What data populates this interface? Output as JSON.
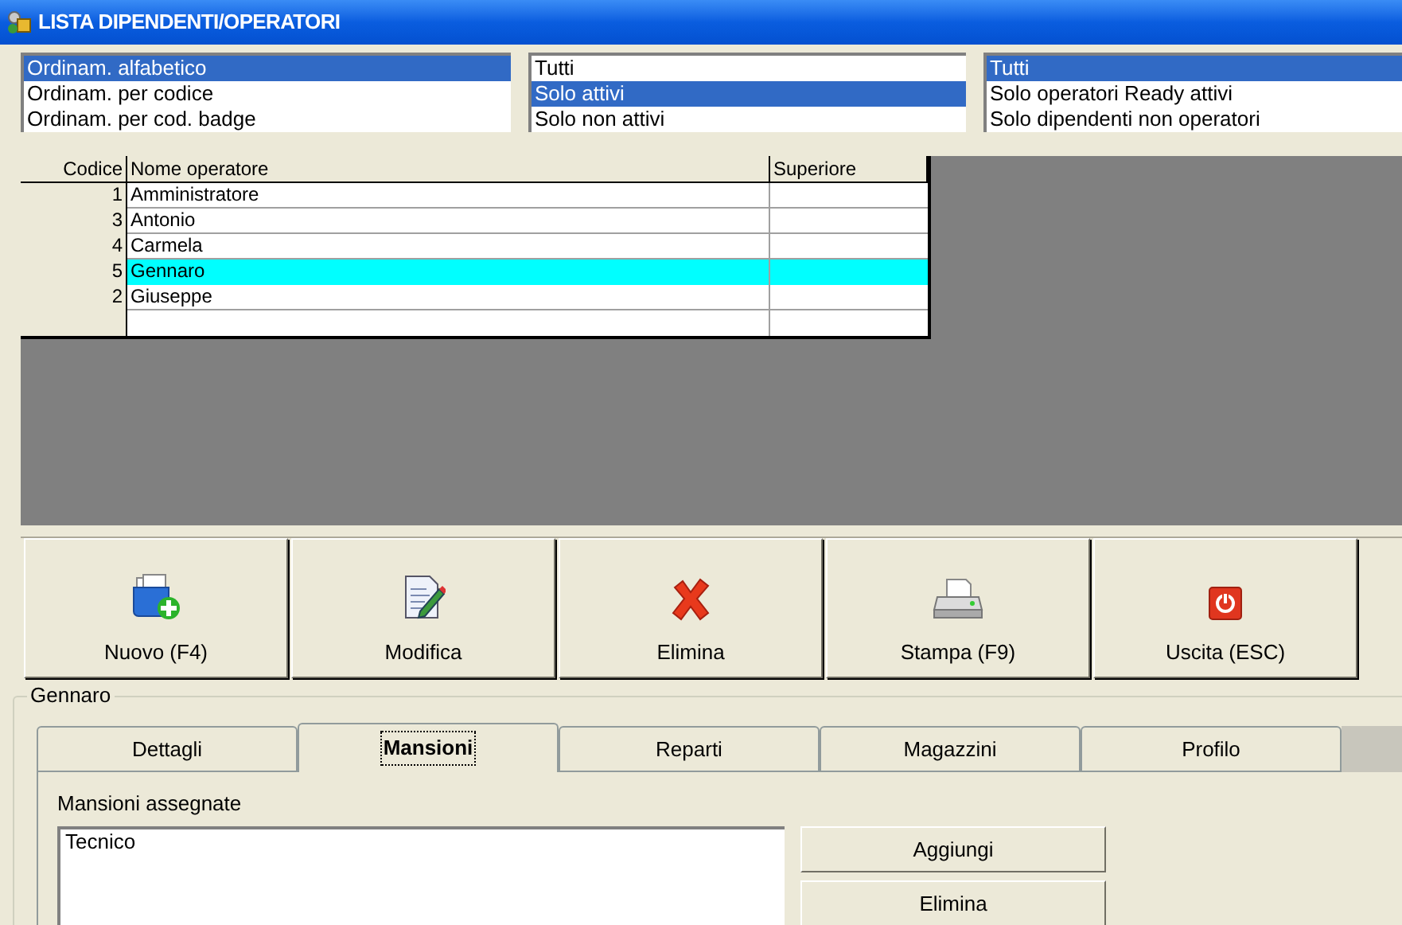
{
  "window": {
    "title": "LISTA DIPENDENTI/OPERATORI"
  },
  "sort_list": [
    {
      "label": "Ordinam. alfabetico",
      "selected": true
    },
    {
      "label": "Ordinam. per codice",
      "selected": false
    },
    {
      "label": "Ordinam. per cod. badge",
      "selected": false
    }
  ],
  "status_filter": [
    {
      "label": "Tutti",
      "selected": false
    },
    {
      "label": "Solo attivi",
      "selected": true
    },
    {
      "label": "Solo non attivi",
      "selected": false
    }
  ],
  "type_filter": [
    {
      "label": "Tutti",
      "selected": true
    },
    {
      "label": "Solo operatori Ready attivi",
      "selected": false
    },
    {
      "label": "Solo dipendenti non operatori",
      "selected": false
    }
  ],
  "table": {
    "columns": [
      "Codice",
      "Nome operatore",
      "Superiore"
    ],
    "rows": [
      {
        "code": "1",
        "name": "Amministratore",
        "selected": false
      },
      {
        "code": "3",
        "name": "Antonio",
        "selected": false
      },
      {
        "code": "4",
        "name": "Carmela",
        "selected": false
      },
      {
        "code": "5",
        "name": "Gennaro",
        "selected": true
      },
      {
        "code": "2",
        "name": "Giuseppe",
        "selected": false
      }
    ]
  },
  "toolbar": [
    {
      "label": "Nuovo (F4)",
      "kind": "new"
    },
    {
      "label": "Modifica",
      "kind": "edit"
    },
    {
      "label": "Elimina",
      "kind": "delete"
    },
    {
      "label": "Stampa (F9)",
      "kind": "print"
    },
    {
      "label": "Uscita (ESC)",
      "kind": "exit"
    }
  ],
  "detail": {
    "title": "Gennaro",
    "tabs": [
      {
        "label": "Dettagli",
        "selected": false
      },
      {
        "label": "Mansioni",
        "selected": true
      },
      {
        "label": "Reparti",
        "selected": false
      },
      {
        "label": "Magazzini",
        "selected": false
      },
      {
        "label": "Profilo",
        "selected": false
      }
    ],
    "list_label": "Mansioni assegnate",
    "assigned": [
      "Tecnico"
    ],
    "buttons": [
      "Aggiungi",
      "Elimina"
    ]
  }
}
